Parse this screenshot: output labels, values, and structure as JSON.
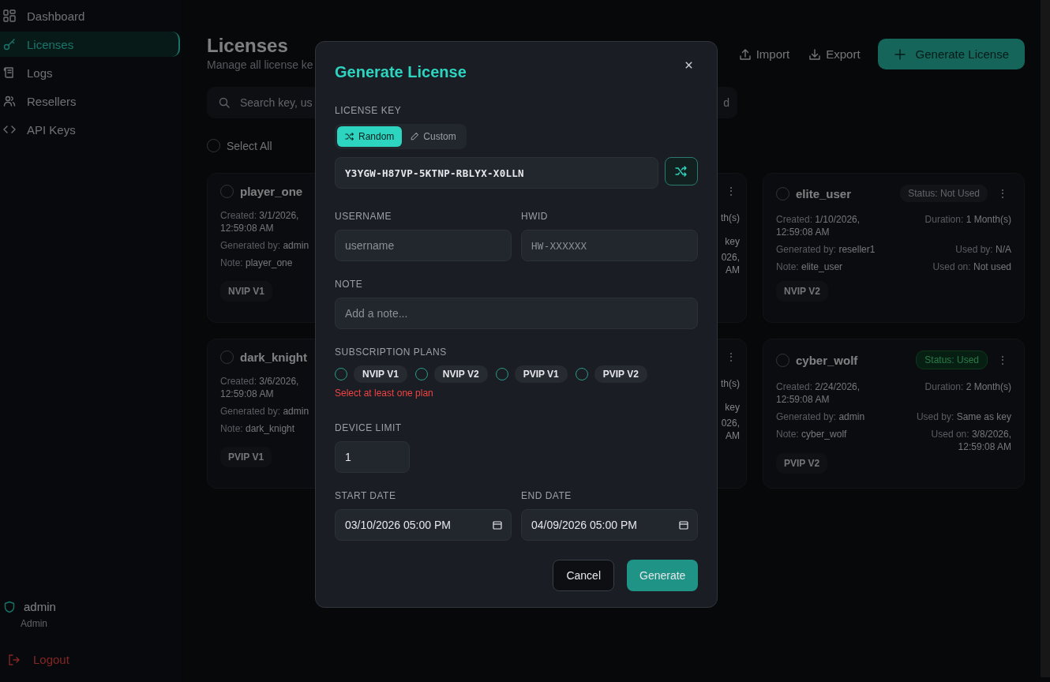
{
  "sidebar": {
    "items": [
      {
        "label": "Dashboard",
        "selected": false
      },
      {
        "label": "Licenses",
        "selected": true
      },
      {
        "label": "Logs",
        "selected": false
      },
      {
        "label": "Resellers",
        "selected": false
      },
      {
        "label": "API Keys",
        "selected": false
      }
    ],
    "user": {
      "name": "admin",
      "role": "Admin"
    },
    "logout": "Logout"
  },
  "header": {
    "title": "Licenses",
    "subtitle": "Manage all license ke",
    "actions": [
      {
        "label": "Import",
        "kind": "import"
      },
      {
        "label": "Export",
        "kind": "export"
      },
      {
        "label": "Generate License",
        "kind": "primary"
      }
    ]
  },
  "search": {
    "placeholder": "Search key, us",
    "trailing": "d"
  },
  "select_all": {
    "label": "Select All",
    "checked": false
  },
  "cards": [
    {
      "kind": "full_left",
      "name": "player_one",
      "checked": false,
      "created_label": "Created:",
      "created": "3/1/2026, 12:59:08 AM",
      "generated_label": "Generated by:",
      "generated": "admin",
      "note_label": "Note:",
      "note": "player_one",
      "tag": "NVIP V1"
    },
    {
      "kind": "fragment",
      "menu": "⋮",
      "lines": [
        "th(s)",
        "key",
        "026,",
        "AM"
      ]
    },
    {
      "kind": "full",
      "name": "elite_user",
      "checked": false,
      "status": "Status: Not Used",
      "used": false,
      "menu": "⋮",
      "created_label": "Created:",
      "created": "1/10/2026, 12:59:08 AM",
      "generated_label": "Generated by:",
      "generated": "reseller1",
      "note_label": "Note:",
      "note": "elite_user",
      "duration_label": "Duration:",
      "duration": "1 Month(s)",
      "used_by_label": "Used by:",
      "used_by": "N/A",
      "used_on_label": "Used on:",
      "used_on": "Not used",
      "tag": "NVIP V2"
    },
    {
      "kind": "full_left",
      "name": "dark_knight",
      "checked": false,
      "created_label": "Created:",
      "created": "3/6/2026, 12:59:08 AM",
      "generated_label": "Generated by:",
      "generated": "admin",
      "note_label": "Note:",
      "note": "dark_knight",
      "tag": "PVIP V1"
    },
    {
      "kind": "fragment",
      "menu": "⋮",
      "lines": [
        "th(s)",
        "key",
        "026,",
        "AM"
      ]
    },
    {
      "kind": "full",
      "name": "cyber_wolf",
      "checked": false,
      "status": "Status: Used",
      "used": true,
      "menu": "⋮",
      "created_label": "Created:",
      "created": "2/24/2026, 12:59:08 AM",
      "generated_label": "Generated by:",
      "generated": "admin",
      "note_label": "Note:",
      "note": "cyber_wolf",
      "duration_label": "Duration:",
      "duration": "2 Month(s)",
      "used_by_label": "Used by:",
      "used_by": "Same as key",
      "used_on_label": "Used on:",
      "used_on": "3/8/2026, 12:59:08 AM",
      "tag": "PVIP V2"
    }
  ],
  "dialog": {
    "title": "Generate License",
    "key_label": "LICENSE KEY",
    "modes": [
      {
        "label": "Random",
        "selected": true
      },
      {
        "label": "Custom",
        "selected": false
      }
    ],
    "key_value": "Y3YGW-H87VP-5KTNP-RBLYX-X0LLN",
    "username_label": "USERNAME",
    "username_placeholder": "username",
    "hwid_label": "HWID",
    "hwid_placeholder": "HW-XXXXXX",
    "note_label": "NOTE",
    "note_placeholder": "Add a note...",
    "plans_label": "SUBSCRIPTION PLANS",
    "plans": [
      {
        "label": "NVIP V1",
        "selected": false
      },
      {
        "label": "NVIP V2",
        "selected": false
      },
      {
        "label": "PVIP V1",
        "selected": false
      },
      {
        "label": "PVIP V2",
        "selected": false
      }
    ],
    "plans_error": "Select at least one plan",
    "device_label": "DEVICE LIMIT",
    "device_value": "1",
    "start_label": "START DATE",
    "start_value": "03/10/2026 05:00 PM",
    "end_label": "END DATE",
    "end_value": "04/09/2026 05:00 PM",
    "buttons": [
      {
        "label": "Cancel",
        "kind": "secondary"
      },
      {
        "label": "Generate",
        "kind": "primary"
      }
    ]
  }
}
